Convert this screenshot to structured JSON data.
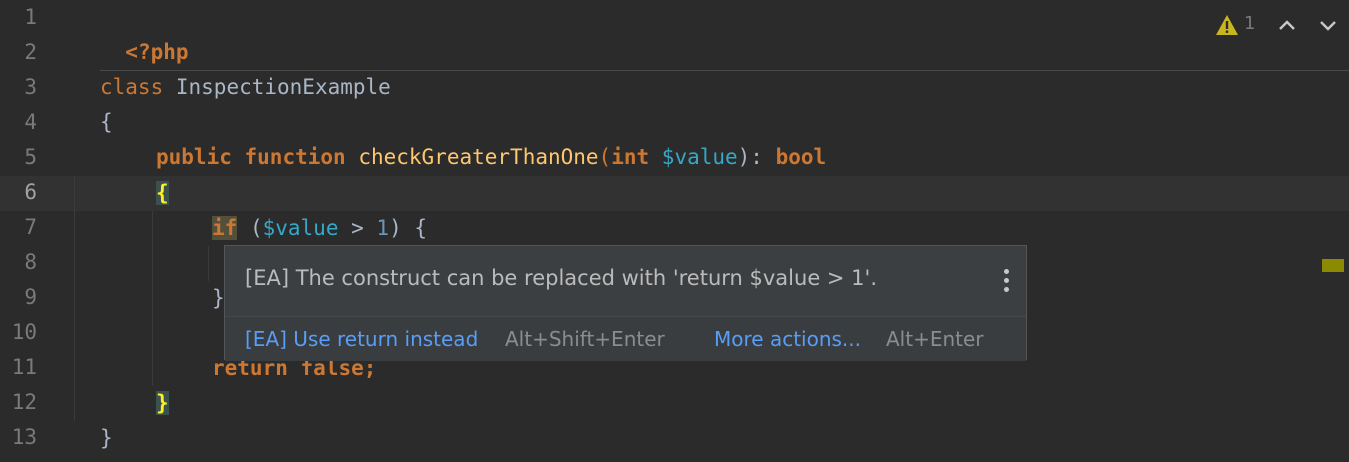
{
  "editor": {
    "line_numbers": [
      "1",
      "2",
      "3",
      "4",
      "5",
      "6",
      "7",
      "8",
      "9",
      "10",
      "11",
      "12",
      "13"
    ],
    "current_line": 6,
    "lines": {
      "l1": {
        "tag": "<?php"
      },
      "l3": {
        "kw": "class",
        "name": "InspectionExample"
      },
      "l4": {
        "brace": "{"
      },
      "l5": {
        "kw1": "public",
        "kw2": "function",
        "fn": "checkGreaterThanOne",
        "open": "(",
        "type": "int",
        "var": "$value",
        "close": "):",
        "ret": "bool"
      },
      "l6": {
        "brace": "{"
      },
      "l7": {
        "kw": "if",
        "open": "(",
        "var": "$value",
        "op": " > ",
        "num": "1",
        "close": ") {"
      },
      "l9": {
        "brace": "}"
      },
      "l11": {
        "kw1": "return",
        "kw2": "false",
        "semi": ";"
      },
      "l12": {
        "brace": "}"
      },
      "l13": {
        "brace": "}"
      }
    }
  },
  "indicators": {
    "warning_count": "1",
    "warning_icon": "warning-triangle-icon",
    "prev_icon": "chevron-up-icon",
    "next_icon": "chevron-down-icon"
  },
  "popup": {
    "message": "[EA] The construct can be replaced with 'return $value > 1'.",
    "primary_action": "[EA] Use return instead",
    "primary_shortcut": "Alt+Shift+Enter",
    "more_actions": "More actions...",
    "more_shortcut": "Alt+Enter"
  },
  "colors": {
    "background": "#2b2b2b",
    "keyword": "#cc7832",
    "function": "#ffc66d",
    "variable": "#34a8c8",
    "number": "#6897bb",
    "link": "#589df6",
    "warning": "#c9b61e"
  }
}
